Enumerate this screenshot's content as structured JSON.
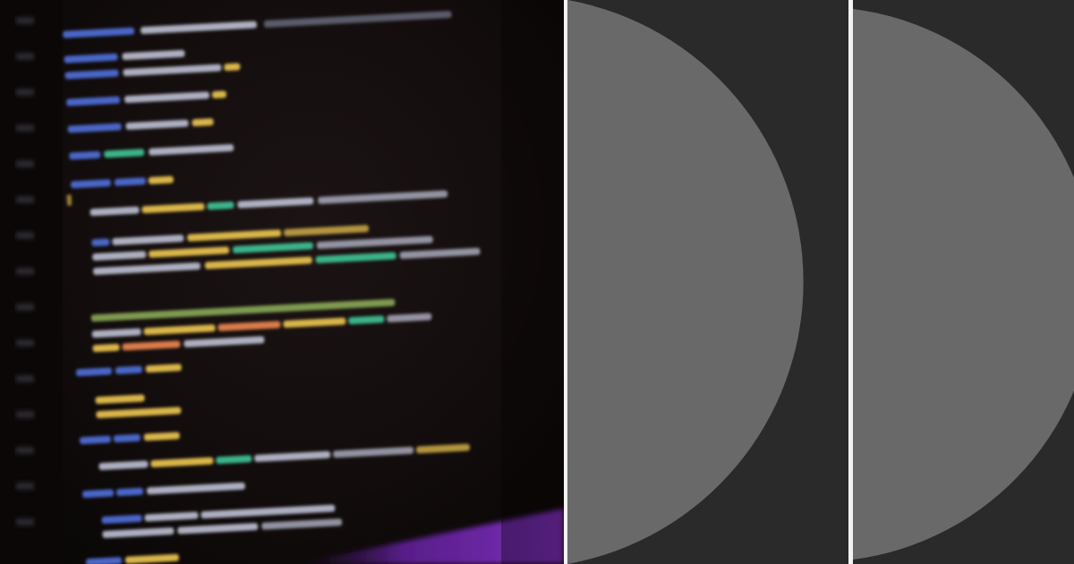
{
  "banner": {
    "panel_fill": "#696969",
    "background": "#2a2a2a",
    "divider": "#f2f2f2"
  },
  "photo": {
    "subject": "blurred-code-screen",
    "palette": {
      "keyword": "#4a66c8",
      "type": "#3bb38a",
      "string": "#d9b64a",
      "identifier": "#c8cbe0",
      "comment": "#8fb35a",
      "accent": "#7a2fb8"
    }
  }
}
